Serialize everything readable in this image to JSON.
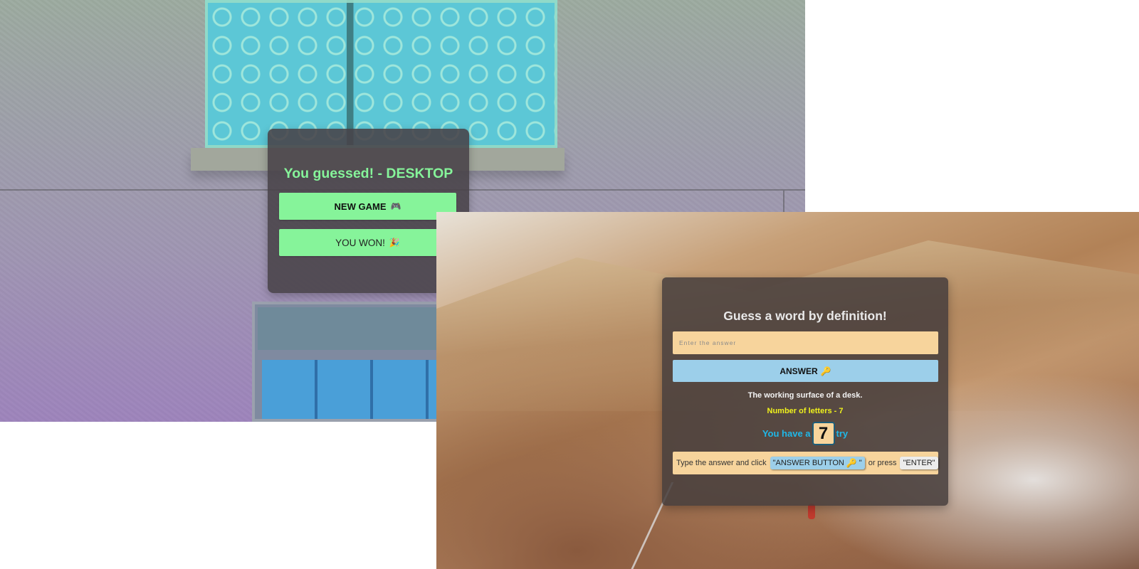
{
  "win_screen": {
    "title": "You guessed! - DESKTOP",
    "new_game": {
      "label": "NEW GAME",
      "icon": "🎮",
      "icon_name": "gamepad-icon"
    },
    "you_won": {
      "label": "YOU WON!",
      "icon": "🎉",
      "icon_name": "party-popper-icon"
    },
    "accent_color": "#86f49a"
  },
  "game_screen": {
    "title": "Guess a word by definition!",
    "answer_input": {
      "placeholder": "Enter the answer",
      "value": ""
    },
    "answer_button": {
      "label": "ANSWER",
      "icon": "🔑",
      "icon_name": "key-icon"
    },
    "definition": "The working surface of a desk.",
    "letters_info": "Number of letters - 7",
    "tries": {
      "prefix": "You have a",
      "count": "7",
      "suffix": "try"
    },
    "hint": {
      "text1": "Type the answer and click",
      "chip_answer_prefix": "\"ANSWER BUTTON",
      "chip_answer_icon": "🔑",
      "chip_answer_suffix": "\"",
      "text2": "or press",
      "chip_enter": "\"ENTER\""
    },
    "colors": {
      "input_bg": "#f7d49c",
      "button_bg": "#9ccfea",
      "letters_text": "#f0f21c",
      "tries_text": "#1fb8e8"
    }
  }
}
